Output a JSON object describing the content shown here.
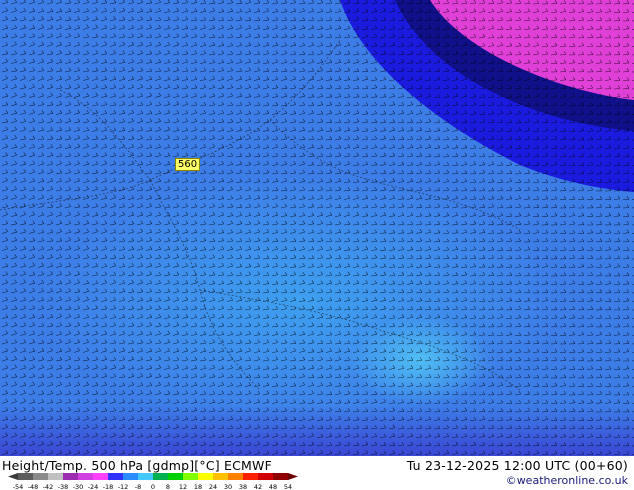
{
  "map": {
    "contour_label": "560",
    "field_colors": {
      "base": "#3d7de8",
      "deep": "#1b1be0",
      "darker": "#10108a",
      "cold": "#3a3ad0",
      "magenta": "#e040d8",
      "light": "#3fa6f2",
      "cyan": "#52c4f5"
    },
    "barb_color": "#000000"
  },
  "footer": {
    "title": "Height/Temp. 500 hPa [gdmp][°C] ECMWF",
    "valid_time": "Tu 23-12-2025 12:00 UTC (00+60)",
    "credit": "©weatheronline.co.uk"
  },
  "colorbar": {
    "ticks": [
      "-54",
      "-48",
      "-42",
      "-38",
      "-30",
      "-24",
      "-18",
      "-12",
      "-8",
      "0",
      "8",
      "12",
      "18",
      "24",
      "30",
      "38",
      "42",
      "48",
      "54"
    ],
    "colors": [
      "#5c5c5c",
      "#8a8a8a",
      "#c0c0c0",
      "#9c2cb0",
      "#d040e0",
      "#ff40ff",
      "#3030ff",
      "#2a8cff",
      "#40c8ff",
      "#00b050",
      "#00d000",
      "#80ff00",
      "#ffff00",
      "#ffc000",
      "#ff8000",
      "#ff2000",
      "#d00000",
      "#900000"
    ]
  }
}
